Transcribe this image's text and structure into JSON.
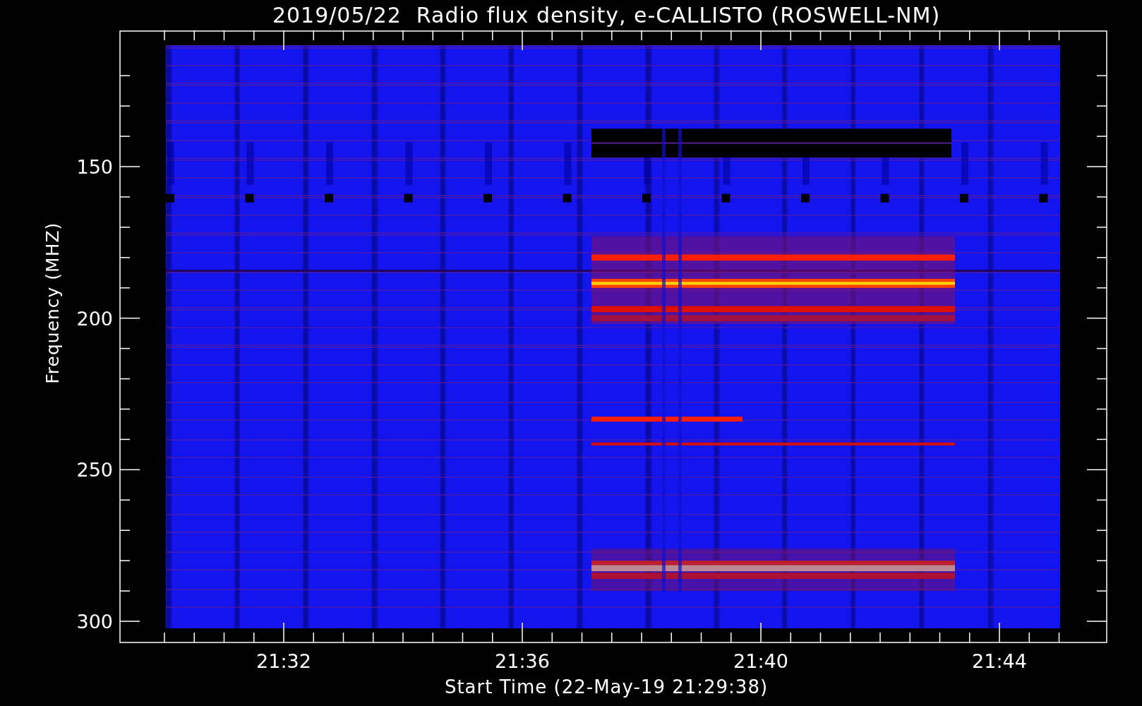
{
  "title": "2019/05/22  Radio flux density, e-CALLISTO (ROSWELL-NM)",
  "y_axis": {
    "label": "Frequency (MHZ)",
    "ticks": [
      "150",
      "200",
      "250",
      "300"
    ]
  },
  "x_axis": {
    "label": "Start Time (22-May-19 21:29:38)",
    "ticks": [
      "21:32",
      "21:36",
      "21:40",
      "21:44"
    ]
  }
}
